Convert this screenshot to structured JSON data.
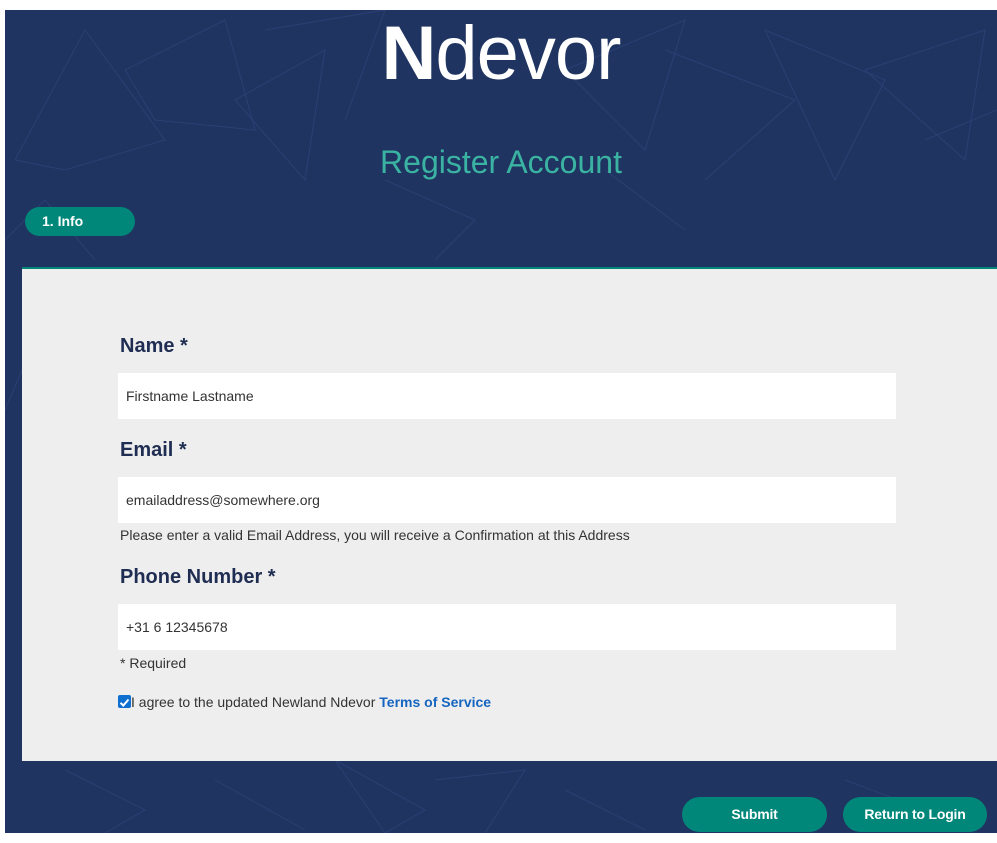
{
  "brand": {
    "logo_first": "N",
    "logo_rest": "devor"
  },
  "page": {
    "title": "Register Account"
  },
  "steps": [
    {
      "label": "1. Info"
    }
  ],
  "form": {
    "name": {
      "label": "Name *",
      "value": "Firstname Lastname"
    },
    "email": {
      "label": "Email *",
      "value": "emailaddress@somewhere.org",
      "hint": "Please enter a valid Email Address, you will receive a Confirmation at this Address"
    },
    "phone": {
      "label": "Phone Number *",
      "value": "+31 6 12345678"
    },
    "required_note": "* Required",
    "terms": {
      "checked": true,
      "text": "I agree to the updated Newland Ndevor ",
      "link": "Terms of Service"
    }
  },
  "actions": {
    "submit": "Submit",
    "return_to_login": "Return to Login"
  },
  "colors": {
    "background": "#1f3461",
    "accent": "#00877a",
    "title_teal": "#3bb3a2",
    "card": "#eeeeee",
    "label_navy": "#1f2d52",
    "link_blue": "#1565c0",
    "checkbox_blue": "#0f6fd0"
  }
}
